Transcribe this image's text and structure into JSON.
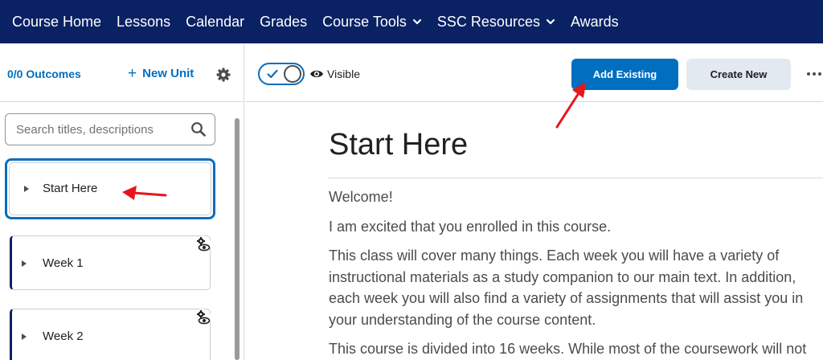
{
  "nav": {
    "items": [
      {
        "label": "Course Home",
        "dropdown": false
      },
      {
        "label": "Lessons",
        "dropdown": false
      },
      {
        "label": "Calendar",
        "dropdown": false
      },
      {
        "label": "Grades",
        "dropdown": false
      },
      {
        "label": "Course Tools",
        "dropdown": true
      },
      {
        "label": "SSC Resources",
        "dropdown": true
      },
      {
        "label": "Awards",
        "dropdown": false
      }
    ]
  },
  "left_toolbar": {
    "outcomes_label": "0/0 Outcomes",
    "new_unit_label": "New Unit",
    "new_unit_icon": "plus-icon",
    "settings_icon": "gear-icon"
  },
  "search": {
    "placeholder": "Search titles, descriptions",
    "value": "",
    "icon": "search-icon"
  },
  "units": [
    {
      "label": "Start Here",
      "selected": true,
      "hidden": false
    },
    {
      "label": "Week 1",
      "selected": false,
      "hidden": true
    },
    {
      "label": "Week 2",
      "selected": false,
      "hidden": true
    }
  ],
  "right_toolbar": {
    "visibility_toggle_on": true,
    "visibility_label": "Visible",
    "add_existing_label": "Add Existing",
    "create_new_label": "Create New",
    "more_icon": "more-horizontal-icon"
  },
  "content": {
    "title": "Start Here",
    "paragraphs": [
      "Welcome!",
      "I am excited that you enrolled in this course.",
      "This class will cover many things. Each week you will have a variety of instructional materials as a study companion to our main text. In addition, each week you will also find a variety of assignments that will assist you in your understanding of the course content.",
      "This course is divided into 16 weeks. While most of the coursework will not"
    ]
  },
  "colors": {
    "nav_bg": "#0a2164",
    "accent": "#006fbf",
    "annotation_arrow": "#e8161b"
  }
}
